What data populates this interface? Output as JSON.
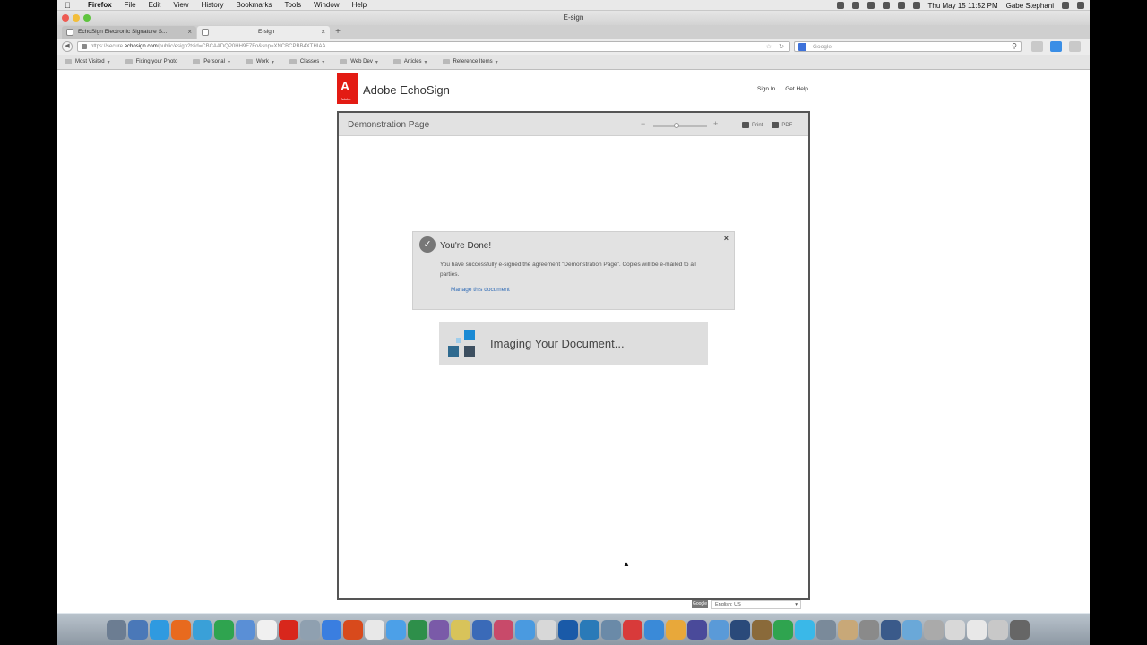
{
  "menubar": {
    "app": "Firefox",
    "menus": [
      "File",
      "Edit",
      "View",
      "History",
      "Bookmarks",
      "Tools",
      "Window",
      "Help"
    ],
    "clock": "Thu May 15  11:52 PM",
    "user": "Gabe Stephani"
  },
  "window": {
    "title": "E-sign"
  },
  "tabs": [
    {
      "label": "EchoSign Electronic Signature S..."
    },
    {
      "label": "E-sign"
    }
  ],
  "navbar": {
    "url_prefix": "https://secure.",
    "url_domain": "echosign.com",
    "url_rest": "/public/esign?tsid=CBCAADQP0HH9F7Fo&snp=XNCBCPBB4XTHIAA",
    "search_placeholder": "Google"
  },
  "bookmarks": [
    "Most Visited",
    "Fixing your Photo",
    "Personal",
    "Work",
    "Classes",
    "Web Dev",
    "Articles",
    "Reference Items"
  ],
  "header": {
    "logo_letter": "A",
    "logo_sub": "Adobe",
    "brand": "Adobe EchoSign",
    "links": [
      "Sign In",
      "Get Help"
    ]
  },
  "document": {
    "title": "Demonstration Page",
    "actions": [
      "Print",
      "PDF"
    ]
  },
  "done_dialog": {
    "title": "You're Done!",
    "message": "You have successfully e-signed the agreement \"Demonstration Page\". Copies will be e-mailed to all parties.",
    "link": "Manage this document"
  },
  "imaging": {
    "text": "Imaging Your Document..."
  },
  "footer": {
    "language": "English: US",
    "badge": "Google"
  },
  "colors": {
    "adobe_red": "#e31b13",
    "link_blue": "#2e6ab5",
    "imaging_blue": "#1a8ad4"
  }
}
